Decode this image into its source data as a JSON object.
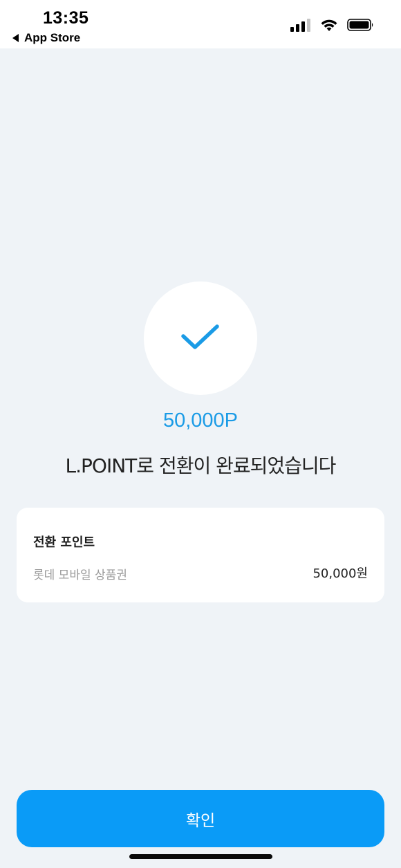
{
  "status_bar": {
    "time": "13:35",
    "back_app": "App Store",
    "icons": [
      "signal-icon",
      "wifi-icon",
      "battery-icon"
    ]
  },
  "result": {
    "icon": "checkmark-icon",
    "points": "50,000P",
    "message": "L.POINT로 전환이 완료되었습니다"
  },
  "card": {
    "title": "전환 포인트",
    "item_label": "롯데 모바일 상품권",
    "item_value": "50,000원"
  },
  "confirm_button": {
    "label": "확인"
  },
  "colors": {
    "accent": "#1a9be6",
    "button": "#0a9bf7",
    "background": "#eff3f7"
  }
}
